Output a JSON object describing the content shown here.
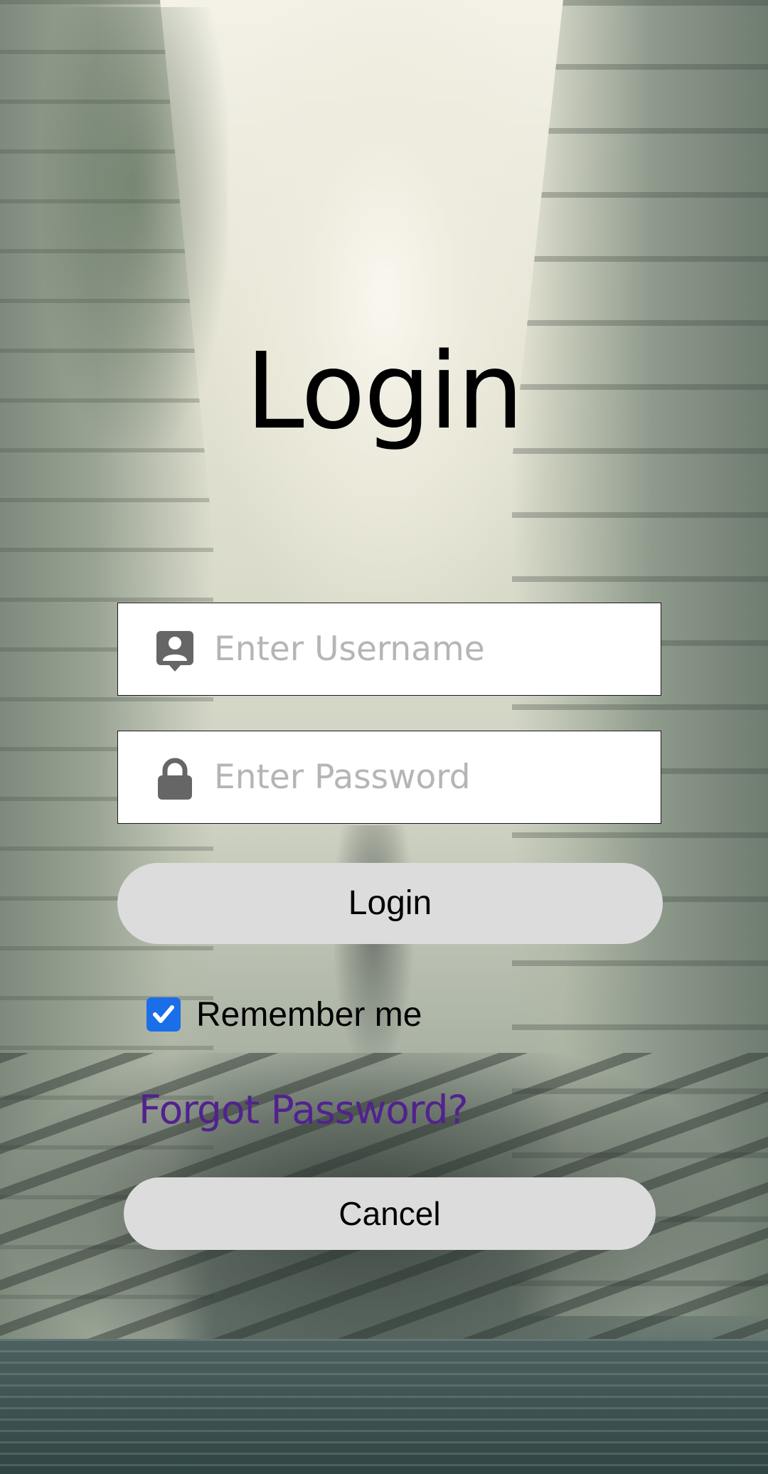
{
  "screen": {
    "title": "Login"
  },
  "username": {
    "placeholder": "Enter Username",
    "value": "",
    "icon": "user-badge-icon"
  },
  "password": {
    "placeholder": "Enter Password",
    "value": "",
    "icon": "lock-icon"
  },
  "actions": {
    "login_label": "Login",
    "cancel_label": "Cancel",
    "forgot_label": "Forgot Password?"
  },
  "remember": {
    "label": "Remember me",
    "checked": true
  },
  "colors": {
    "checkbox_accent": "#1a6ee8",
    "forgot_link": "#51228f",
    "button_bg": "#dcdcdc",
    "icon_gray": "#666666"
  }
}
